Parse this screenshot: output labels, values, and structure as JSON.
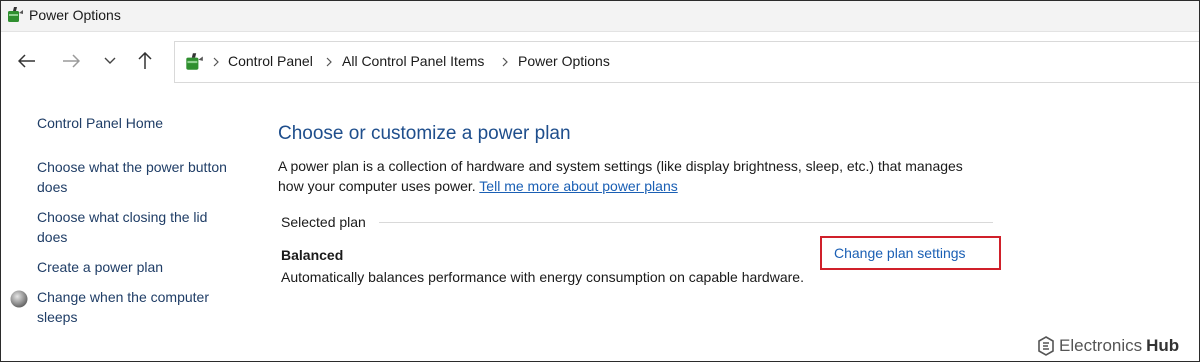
{
  "window": {
    "title": "Power Options"
  },
  "nav": {
    "back": "Back",
    "forward": "Forward",
    "recent": "Recent locations",
    "up": "Up"
  },
  "breadcrumb": {
    "items": [
      "Control Panel",
      "All Control Panel Items",
      "Power Options"
    ]
  },
  "sidebar": {
    "items": [
      {
        "label": "Control Panel Home"
      },
      {
        "label": "Choose what the power button does"
      },
      {
        "label": "Choose what closing the lid does"
      },
      {
        "label": "Create a power plan"
      },
      {
        "label": "Change when the computer sleeps"
      }
    ]
  },
  "main": {
    "title": "Choose or customize a power plan",
    "description": "A power plan is a collection of hardware and system settings (like display brightness, sleep, etc.) that manages how your computer uses power.",
    "learn_more_link": "Tell me more about power plans",
    "selected_plan_label": "Selected plan",
    "plan": {
      "name": "Balanced",
      "description": "Automatically balances performance with energy consumption on capable hardware.",
      "change_link": "Change plan settings"
    }
  },
  "watermark": {
    "text_light": "Electronics",
    "text_bold": "Hub"
  },
  "colors": {
    "link": "#1a5fb4",
    "title_blue": "#1e4e8c",
    "highlight_border": "#d0202a"
  }
}
